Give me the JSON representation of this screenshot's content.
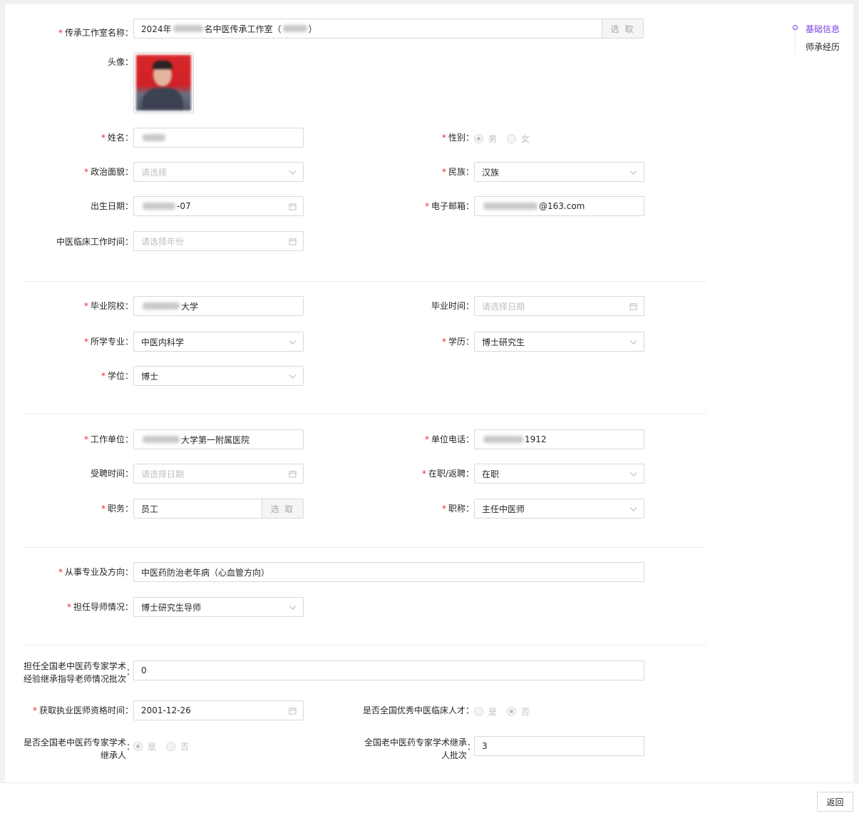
{
  "form": {
    "studio_name": {
      "label": "传承工作室名称",
      "value_prefix": "2024年",
      "value_mid": "名中医传承工作室（",
      "value_suffix": "）",
      "pick": "选 取"
    },
    "avatar": {
      "label": "头像"
    },
    "name": {
      "label": "姓名"
    },
    "gender": {
      "label": "性别",
      "options": [
        "男",
        "女"
      ],
      "selected": "男"
    },
    "political": {
      "label": "政治面貌",
      "placeholder": "请选择"
    },
    "ethnicity": {
      "label": "民族",
      "value": "汉族"
    },
    "birth": {
      "label": "出生日期",
      "value_suffix": "-07"
    },
    "email": {
      "label": "电子邮箱",
      "value_suffix": "@163.com"
    },
    "clinical_time": {
      "label": "中医临床工作时间",
      "placeholder": "请选择年份"
    },
    "school": {
      "label": "毕业院校",
      "value_suffix": "大学"
    },
    "grad_time": {
      "label": "毕业时间",
      "placeholder": "请选择日期"
    },
    "major": {
      "label": "所学专业",
      "value": "中医内科学"
    },
    "education": {
      "label": "学历",
      "value": "博士研究生"
    },
    "degree": {
      "label": "学位",
      "value": "博士"
    },
    "employer": {
      "label": "工作单位",
      "value_suffix": "大学第一附属医院"
    },
    "phone": {
      "label": "单位电话",
      "value_suffix": "1912"
    },
    "hire_time": {
      "label": "受聘时间",
      "placeholder": "请选择日期"
    },
    "status": {
      "label": "在职/返聘",
      "value": "在职"
    },
    "position": {
      "label": "职务",
      "value": "员工",
      "pick": "选 取"
    },
    "title": {
      "label": "职称",
      "value": "主任中医师"
    },
    "direction": {
      "label": "从事专业及方向",
      "value": "中医药防治老年病（心血管方向）"
    },
    "tutor": {
      "label": "担任导师情况",
      "value": "博士研究生导师"
    },
    "mentor_batch": {
      "label_line1": "担任全国老中医药专家学术",
      "label_line2": "经验继承指导老师情况批次",
      "value": "0"
    },
    "license_time": {
      "label": "获取执业医师资格时间",
      "value": "2001-12-26"
    },
    "excellent_talent": {
      "label": "是否全国优秀中医临床人才",
      "options": [
        "是",
        "否"
      ],
      "selected": "否"
    },
    "successor": {
      "label_line1": "是否全国老中医药专家学术",
      "label_line2": "继承人",
      "options": [
        "是",
        "否"
      ],
      "selected": "是"
    },
    "successor_batch": {
      "label_line1": "全国老中医药专家学术继承",
      "label_line2": "人批次",
      "value": "3"
    }
  },
  "anchor": {
    "items": [
      "基础信息",
      "师承经历"
    ],
    "active": "基础信息"
  },
  "footer": {
    "back_label": "返回"
  },
  "colors": {
    "accent": "#7b3fe4",
    "required": "#f5222d"
  }
}
